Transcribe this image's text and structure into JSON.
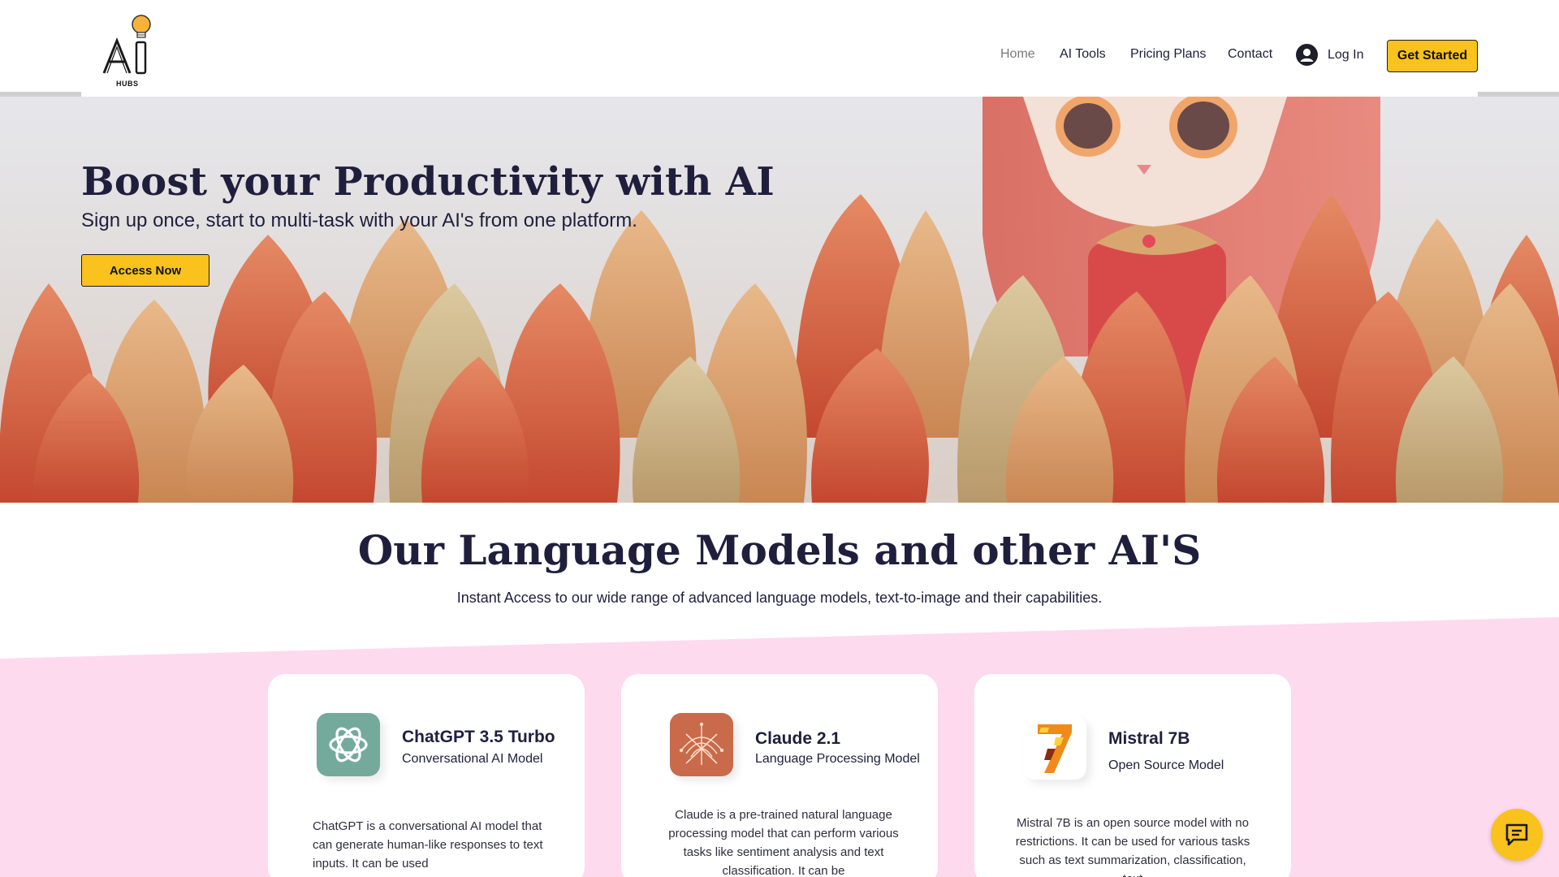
{
  "brand": {
    "logo_text": "AI",
    "logo_sub": "HUBS",
    "logo_icon": "lightbulb-icon",
    "accent": "#f9c21c",
    "pink": "#fddaee"
  },
  "nav": {
    "items": [
      {
        "label": "Home",
        "active": true
      },
      {
        "label": "AI Tools",
        "active": false
      },
      {
        "label": "Pricing Plans",
        "active": false
      },
      {
        "label": "Contact",
        "active": false
      }
    ],
    "login_label": "Log In",
    "login_icon": "user-avatar-icon",
    "cta_label": "Get Started"
  },
  "hero": {
    "title": "Boost your Productivity with AI",
    "subtitle": "Sign up once, start to multi-task with your AI's from one platform.",
    "button_label": "Access Now"
  },
  "models": {
    "title": "Our Language Models and other AI'S",
    "subtitle": "Instant Access to our wide range of advanced language models, text-to-image and their capabilities.",
    "cards": [
      {
        "name": "ChatGPT 3.5 Turbo",
        "type": "Conversational AI Model",
        "icon": "openai-icon",
        "description": "ChatGPT is a conversational AI model that can generate human-like responses to text inputs. It can be used"
      },
      {
        "name": "Claude 2.1",
        "type": "Language Processing Model",
        "icon": "claude-icon",
        "description": "Claude is a pre-trained natural language processing model that can perform various tasks like sentiment analysis and text classification. It can be"
      },
      {
        "name": "Mistral 7B",
        "type": "Open Source Model",
        "icon": "mistral-icon",
        "description": "Mistral 7B is an open source model with no restrictions. It can be used for various tasks such as text summarization, classification, text"
      }
    ]
  },
  "chat_widget": {
    "icon": "chat-bubble-icon"
  }
}
